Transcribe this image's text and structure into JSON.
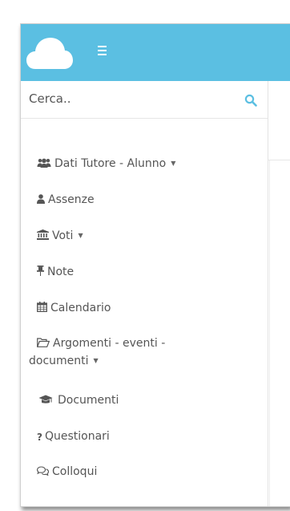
{
  "search": {
    "placeholder": "Cerca.."
  },
  "menu": {
    "dati_tutore": "Dati Tutore - Alunno",
    "assenze": "Assenze",
    "voti": "Voti",
    "note": "Note",
    "calendario": "Calendario",
    "argomenti_line1": "Argomenti - eventi -",
    "argomenti_line2": "documenti",
    "documenti": "Documenti",
    "questionari_icon": "?",
    "questionari": "Questionari",
    "colloqui": "Colloqui",
    "caret": "▼"
  },
  "colors": {
    "topbar": "#5bbfe2",
    "search_icon": "#5bbfe2",
    "menu_text": "#555555"
  },
  "icons": {
    "logo": "cloud-logo-icon",
    "toggle": "hamburger-menu-icon",
    "search": "search-icon",
    "dati_tutore": "users-icon",
    "assenze": "user-icon",
    "voti": "bank-icon",
    "note": "pushpin-icon",
    "calendario": "calendar-icon",
    "argomenti": "folder-open-icon",
    "documenti": "graduation-cap-icon",
    "questionari": "question-icon",
    "colloqui": "comments-icon"
  }
}
